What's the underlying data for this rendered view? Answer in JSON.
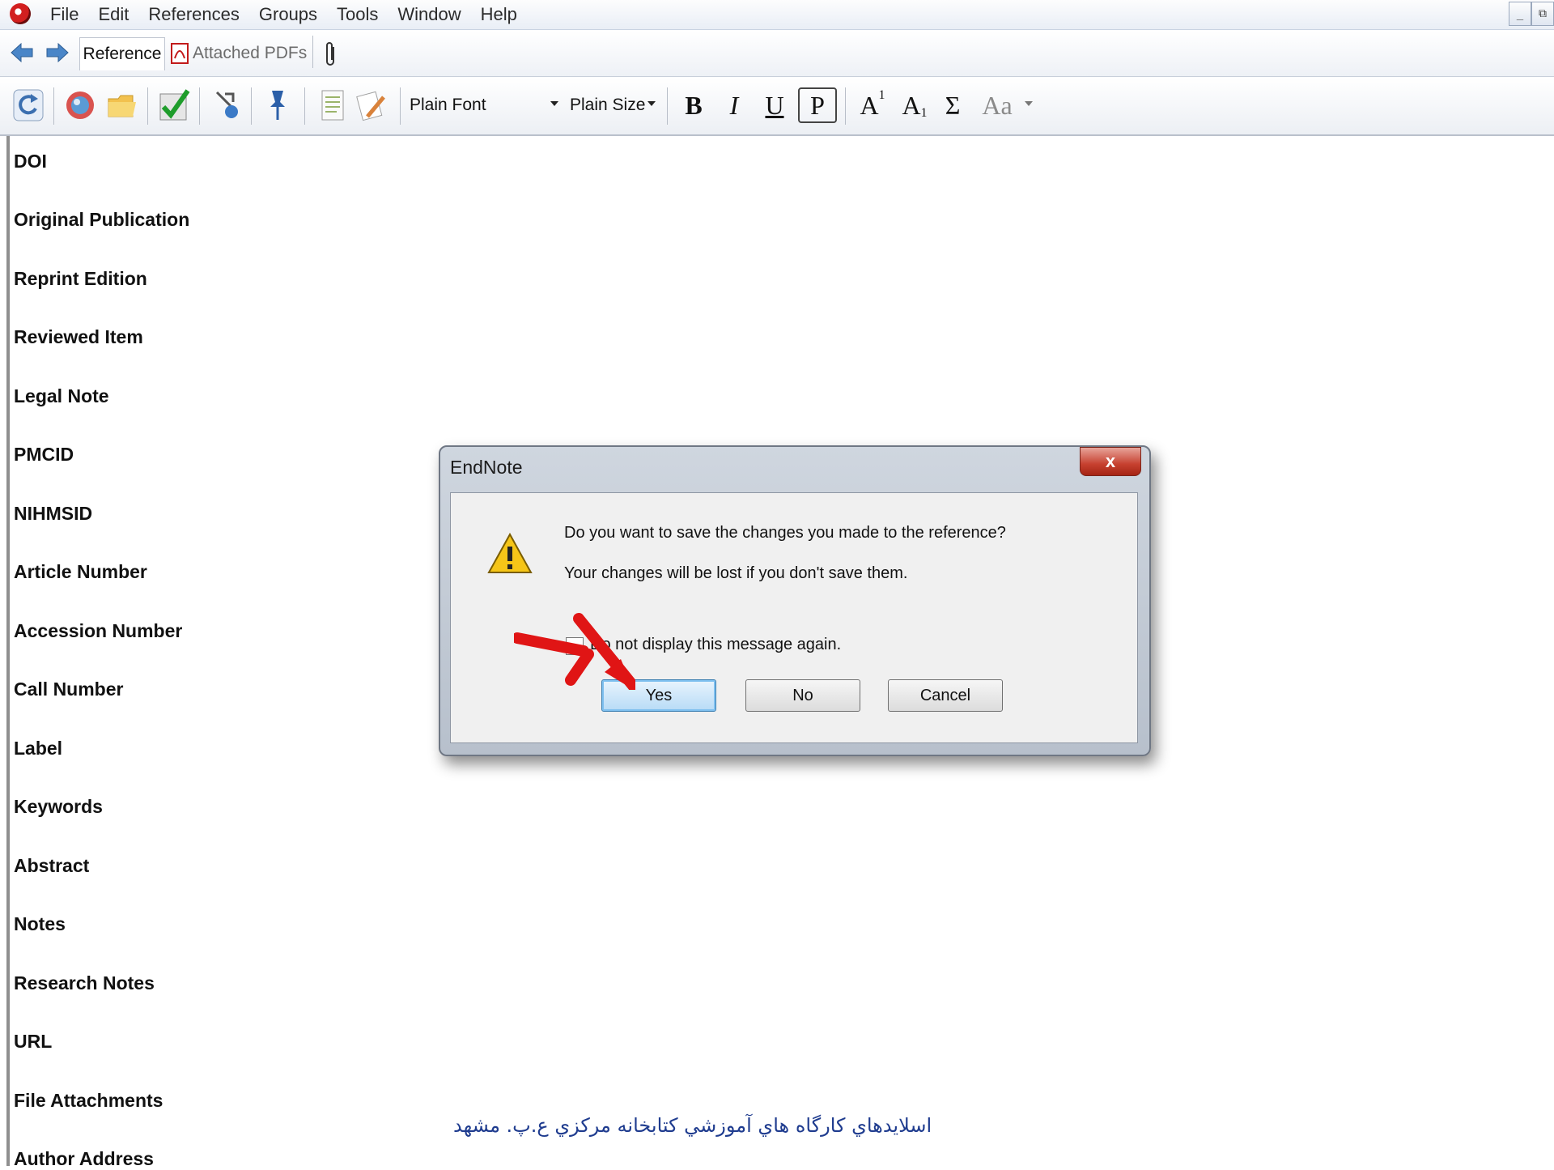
{
  "menu": {
    "items": [
      "File",
      "Edit",
      "References",
      "Groups",
      "Tools",
      "Window",
      "Help"
    ],
    "controls": [
      "_",
      "⧉"
    ]
  },
  "tabs": {
    "reference": "Reference",
    "attached_pdfs": "Attached PDFs"
  },
  "toolbar": {
    "font_select": "Plain Font",
    "size_select": "Plain Size",
    "bold": "B",
    "italic": "I",
    "underline": "U",
    "plain": "P",
    "superscript": "A",
    "superscript_mark": "1",
    "subscript": "A",
    "subscript_mark": "1",
    "symbol": "Σ",
    "case": "Aa"
  },
  "fields": [
    "DOI",
    "Original Publication",
    "Reprint Edition",
    "Reviewed Item",
    "Legal Note",
    "PMCID",
    "NIHMSID",
    "Article Number",
    "Accession Number",
    "Call Number",
    "Label",
    "Keywords",
    "Abstract",
    "Notes",
    "Research Notes",
    "URL",
    "File Attachments",
    "Author Address"
  ],
  "dialog": {
    "title": "EndNote",
    "close": "x",
    "message_primary": "Do you want to save the changes you made to the reference?",
    "message_secondary": "Your changes will be lost if you don't save them.",
    "checkbox_label": "Do not display this message again.",
    "yes": "Yes",
    "no": "No",
    "cancel": "Cancel"
  },
  "footer": {
    "caption": "اسلايدهاي كارگاه هاي آموزشي كتابخانه مركزي ع.پ. مشهد"
  },
  "colors": {
    "accent_arrow": "#e01515",
    "footer_text": "#1f3c8f",
    "yes_button": "#b7dbf6"
  }
}
